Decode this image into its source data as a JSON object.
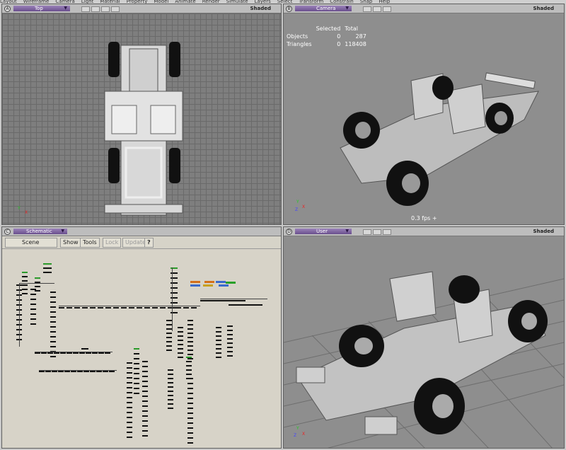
{
  "menubar": [
    "Layout",
    "Wireframe",
    "Camera",
    "Light",
    "Material",
    "Property",
    "Model",
    "Animate",
    "Render",
    "Simulate",
    "Layers",
    "Select",
    "Transform",
    "Constrain",
    "Snap",
    "Help"
  ],
  "viewports": {
    "a": {
      "letter": "A",
      "title": "Top",
      "mode": "Shaded"
    },
    "b": {
      "letter": "B",
      "title": "Camera",
      "mode": "Shaded",
      "stats": {
        "headers": [
          "Selected",
          "Total"
        ],
        "rows": [
          {
            "label": "Objects",
            "selected": "0",
            "total": "287"
          },
          {
            "label": "Triangles",
            "selected": "0",
            "total": "118408"
          }
        ]
      },
      "fps": "0.3 fps +"
    },
    "c": {
      "letter": "C",
      "title": "Schematic",
      "toolbar": {
        "scene": "Scene",
        "show": "Show",
        "tools": "Tools",
        "lock": "Lock",
        "update": "Update",
        "help": "?"
      }
    },
    "d": {
      "letter": "D",
      "title": "User",
      "mode": "Shaded"
    }
  },
  "axes": {
    "y": "Y",
    "x": "X",
    "z": "Z"
  },
  "colors": {
    "title_bar": "#7a5fa0",
    "grid": "#7e7e7e",
    "schematic_bg": "#d7d3c8",
    "node": "#111111",
    "node_selected": "#2a9a2a"
  }
}
